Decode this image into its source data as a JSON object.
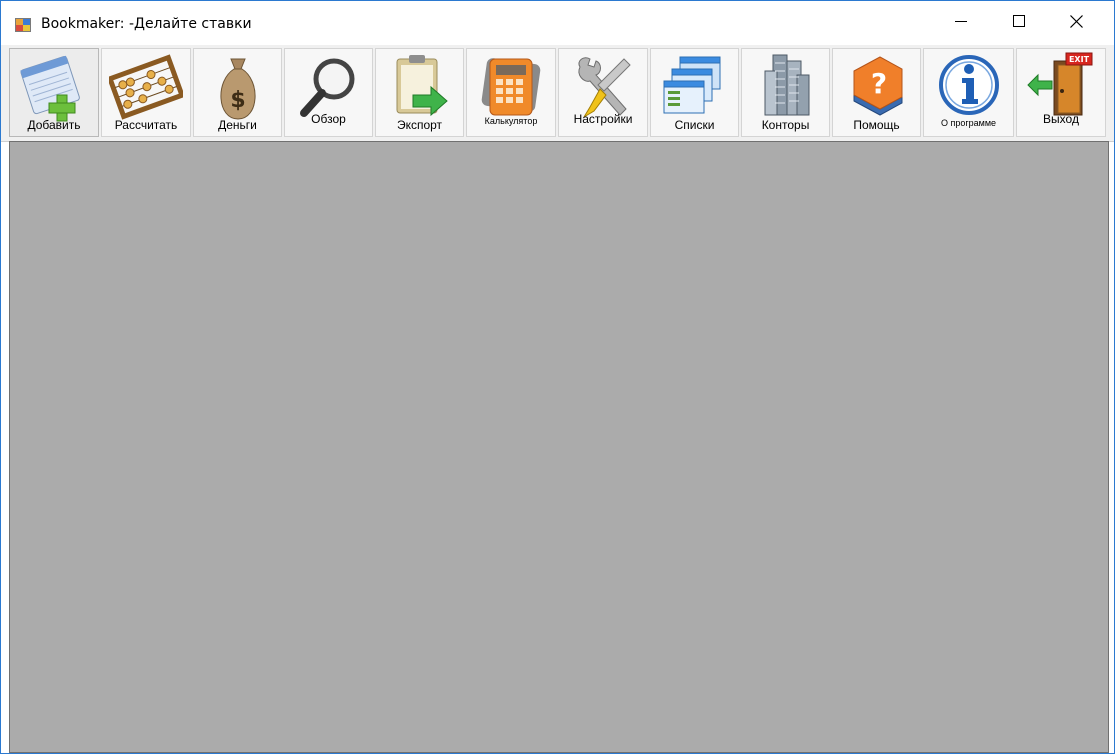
{
  "window": {
    "title": "Bookmaker: -Делайте ставки",
    "app_icon": "app-form-icon"
  },
  "titlebar_controls": {
    "minimize_icon": "minimize-icon",
    "maximize_icon": "maximize-icon",
    "close_icon": "close-icon"
  },
  "toolbar": {
    "buttons": [
      {
        "id": "add",
        "label": "Добавить",
        "icon": "notepad-plus-icon"
      },
      {
        "id": "calculate",
        "label": "Рассчитать",
        "icon": "abacus-icon"
      },
      {
        "id": "money",
        "label": "Деньги",
        "icon": "money-bag-icon"
      },
      {
        "id": "overview",
        "label": "Обзор",
        "icon": "magnifier-icon"
      },
      {
        "id": "export",
        "label": "Экспорт",
        "icon": "export-clipboard-icon"
      },
      {
        "id": "calculator",
        "label": "Калькулятор",
        "icon": "calculator-icon"
      },
      {
        "id": "settings",
        "label": "Настройки",
        "icon": "tools-icon"
      },
      {
        "id": "lists",
        "label": "Списки",
        "icon": "lists-icon"
      },
      {
        "id": "offices",
        "label": "Конторы",
        "icon": "buildings-icon"
      },
      {
        "id": "help",
        "label": "Помощь",
        "icon": "help-book-icon"
      },
      {
        "id": "about",
        "label": "О программе",
        "icon": "info-icon"
      },
      {
        "id": "exit",
        "label": "Выход",
        "icon": "exit-door-icon"
      }
    ]
  },
  "colors": {
    "window_border": "#2b79d0",
    "toolbar_bg": "#f0f0f0",
    "mdi_background": "#ababab"
  }
}
